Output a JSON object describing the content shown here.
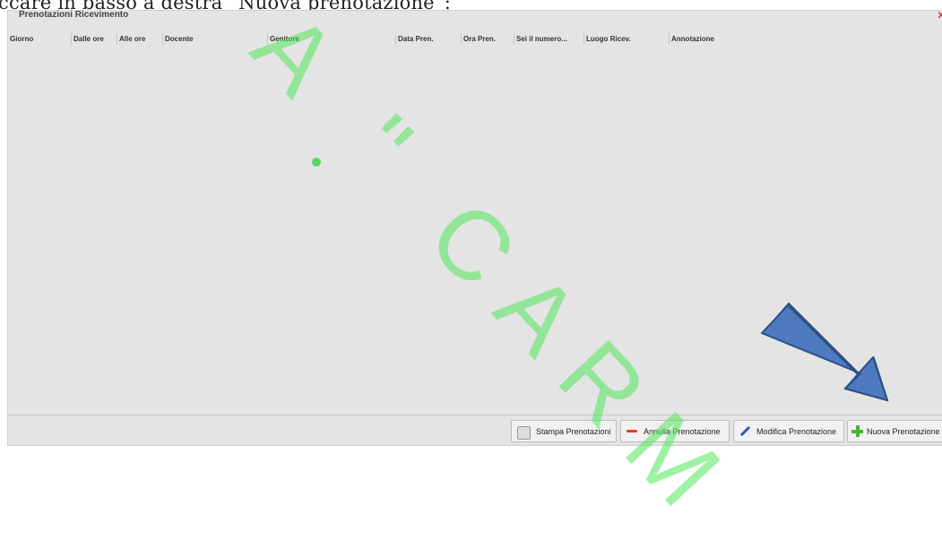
{
  "document_text": "ccare  in basso a destra “Nuova prenotazione”:",
  "window": {
    "title": "Prenotazioni Ricevimento",
    "close_glyph": "x"
  },
  "columns": [
    "Giorno",
    "Dalle ore",
    "Alle ore",
    "Docente",
    "Genitore",
    "Data Pren.",
    "Ora Pren.",
    "Sei il numero...",
    "Luogo Ricev.",
    "Annotazione"
  ],
  "buttons": {
    "stampa": "Stampa Prenotazioni",
    "annulla": "Annulla Prenotazione",
    "modifica": "Modifica Prenotazione",
    "nuova": "Nuova Prenotazione"
  },
  "watermark": "A \" CARM",
  "icons": {
    "stampa": "printer-icon",
    "annulla": "minus-icon",
    "modifica": "pencil-icon",
    "nuova": "plus-icon",
    "arrow": "arrow-down-right-icon"
  },
  "colors": {
    "arrow_fill": "#4e7bbf",
    "arrow_stroke": "#2c4f86",
    "watermark": "#46dc52",
    "panel_bg": "#e4e4e4"
  }
}
